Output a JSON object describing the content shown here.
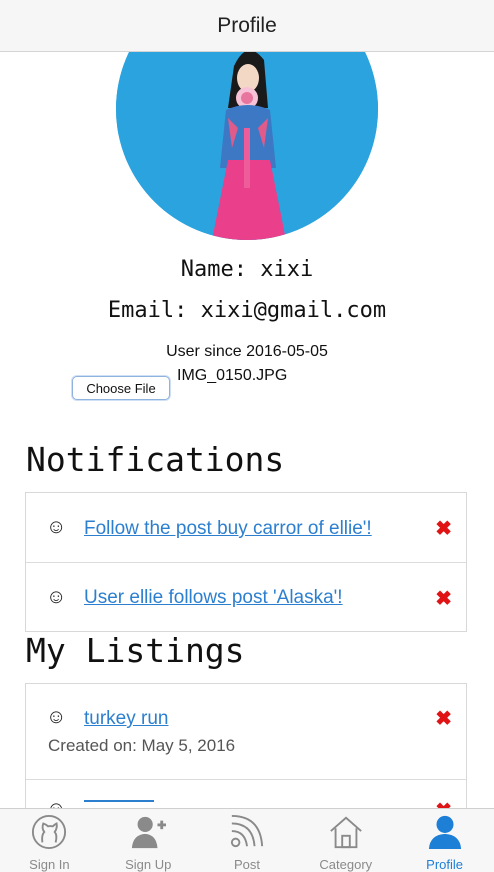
{
  "header": {
    "title": "Profile"
  },
  "profile": {
    "name_line": "Name: xixi",
    "email_line": "Email: xixi@gmail.com",
    "since": "User since 2016-05-05",
    "file_button": "Choose File",
    "file_name": "IMG_0150.JPG"
  },
  "notifications": {
    "title": "Notifications",
    "items": [
      {
        "text": "Follow the post buy carror of ellie'!"
      },
      {
        "text": "User ellie follows post 'Alaska'!"
      }
    ]
  },
  "listings": {
    "title": "My Listings",
    "items": [
      {
        "text": "turkey run",
        "created": "Created on: May 5, 2016"
      }
    ]
  },
  "tabs": [
    {
      "label": "Sign In",
      "icon": "github-icon"
    },
    {
      "label": "Sign Up",
      "icon": "add-user-icon"
    },
    {
      "label": "Post",
      "icon": "rss-icon"
    },
    {
      "label": "Category",
      "icon": "home-icon"
    },
    {
      "label": "Profile",
      "icon": "user-icon",
      "active": true
    }
  ],
  "colors": {
    "link": "#2c7fcf",
    "delete": "#e01414",
    "active_tab": "#1e7fd6",
    "avatar_bg": "#2aa3de"
  }
}
